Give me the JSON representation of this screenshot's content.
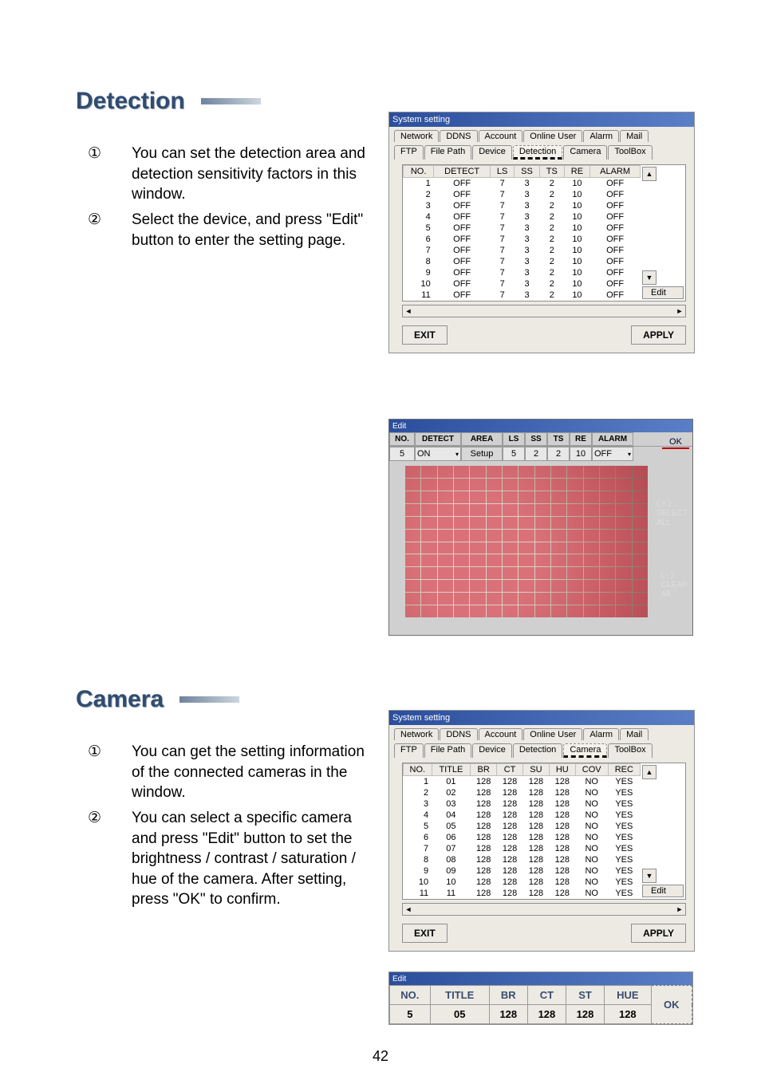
{
  "page_number": "42",
  "sections": {
    "detection": {
      "title": "Detection",
      "bullets": [
        "You can set the detection area and detection sensitivity factors in this window.",
        "Select the device, and press \"Edit\" button to enter the setting page."
      ]
    },
    "camera": {
      "title": "Camera",
      "bullets": [
        "You can get the setting information of the connected cameras in the window.",
        "You can select a specific camera and press \"Edit\" button to set the brightness / contrast / saturation / hue of the camera. After setting, press \"OK\" to confirm."
      ]
    }
  },
  "bullet_marks": [
    "①",
    "②"
  ],
  "sys_window": {
    "title": "System setting",
    "tabs_row1": [
      "Network",
      "DDNS",
      "Account",
      "Online User",
      "Alarm",
      "Mail"
    ],
    "tabs_row2": [
      "FTP",
      "File Path",
      "Device",
      "Detection",
      "Camera",
      "ToolBox"
    ],
    "buttons": {
      "exit": "EXIT",
      "apply": "APPLY",
      "edit": "Edit"
    }
  },
  "detection_table": {
    "active_tab": "Detection",
    "headers": [
      "NO.",
      "DETECT",
      "LS",
      "SS",
      "TS",
      "RE",
      "ALARM"
    ],
    "rows": [
      [
        "1",
        "OFF",
        "7",
        "3",
        "2",
        "10",
        "OFF"
      ],
      [
        "2",
        "OFF",
        "7",
        "3",
        "2",
        "10",
        "OFF"
      ],
      [
        "3",
        "OFF",
        "7",
        "3",
        "2",
        "10",
        "OFF"
      ],
      [
        "4",
        "OFF",
        "7",
        "3",
        "2",
        "10",
        "OFF"
      ],
      [
        "5",
        "OFF",
        "7",
        "3",
        "2",
        "10",
        "OFF"
      ],
      [
        "6",
        "OFF",
        "7",
        "3",
        "2",
        "10",
        "OFF"
      ],
      [
        "7",
        "OFF",
        "7",
        "3",
        "2",
        "10",
        "OFF"
      ],
      [
        "8",
        "OFF",
        "7",
        "3",
        "2",
        "10",
        "OFF"
      ],
      [
        "9",
        "OFF",
        "7",
        "3",
        "2",
        "10",
        "OFF"
      ],
      [
        "10",
        "OFF",
        "7",
        "3",
        "2",
        "10",
        "OFF"
      ],
      [
        "11",
        "OFF",
        "7",
        "3",
        "2",
        "10",
        "OFF"
      ]
    ]
  },
  "detection_edit": {
    "title": "Edit",
    "headers": [
      "NO.",
      "DETECT",
      "AREA",
      "LS",
      "SS",
      "TS",
      "RE",
      "ALARM"
    ],
    "values": [
      "5",
      "ON",
      "Setup",
      "5",
      "2",
      "2",
      "10",
      "OFF"
    ],
    "ok": "OK",
    "select_all": "( + )\nSELECT\nALL",
    "clear_all": "( - )\nCLEAR\nAll"
  },
  "camera_table": {
    "active_tab": "Camera",
    "headers": [
      "NO.",
      "TITLE",
      "BR",
      "CT",
      "SU",
      "HU",
      "COV",
      "REC"
    ],
    "rows": [
      [
        "1",
        "01",
        "128",
        "128",
        "128",
        "128",
        "NO",
        "YES"
      ],
      [
        "2",
        "02",
        "128",
        "128",
        "128",
        "128",
        "NO",
        "YES"
      ],
      [
        "3",
        "03",
        "128",
        "128",
        "128",
        "128",
        "NO",
        "YES"
      ],
      [
        "4",
        "04",
        "128",
        "128",
        "128",
        "128",
        "NO",
        "YES"
      ],
      [
        "5",
        "05",
        "128",
        "128",
        "128",
        "128",
        "NO",
        "YES"
      ],
      [
        "6",
        "06",
        "128",
        "128",
        "128",
        "128",
        "NO",
        "YES"
      ],
      [
        "7",
        "07",
        "128",
        "128",
        "128",
        "128",
        "NO",
        "YES"
      ],
      [
        "8",
        "08",
        "128",
        "128",
        "128",
        "128",
        "NO",
        "YES"
      ],
      [
        "9",
        "09",
        "128",
        "128",
        "128",
        "128",
        "NO",
        "YES"
      ],
      [
        "10",
        "10",
        "128",
        "128",
        "128",
        "128",
        "NO",
        "YES"
      ],
      [
        "11",
        "11",
        "128",
        "128",
        "128",
        "128",
        "NO",
        "YES"
      ]
    ]
  },
  "camera_edit": {
    "title": "Edit",
    "headers": [
      "NO.",
      "TITLE",
      "BR",
      "CT",
      "ST",
      "HUE"
    ],
    "values": [
      "5",
      "05",
      "128",
      "128",
      "128",
      "128"
    ],
    "ok": "OK"
  }
}
